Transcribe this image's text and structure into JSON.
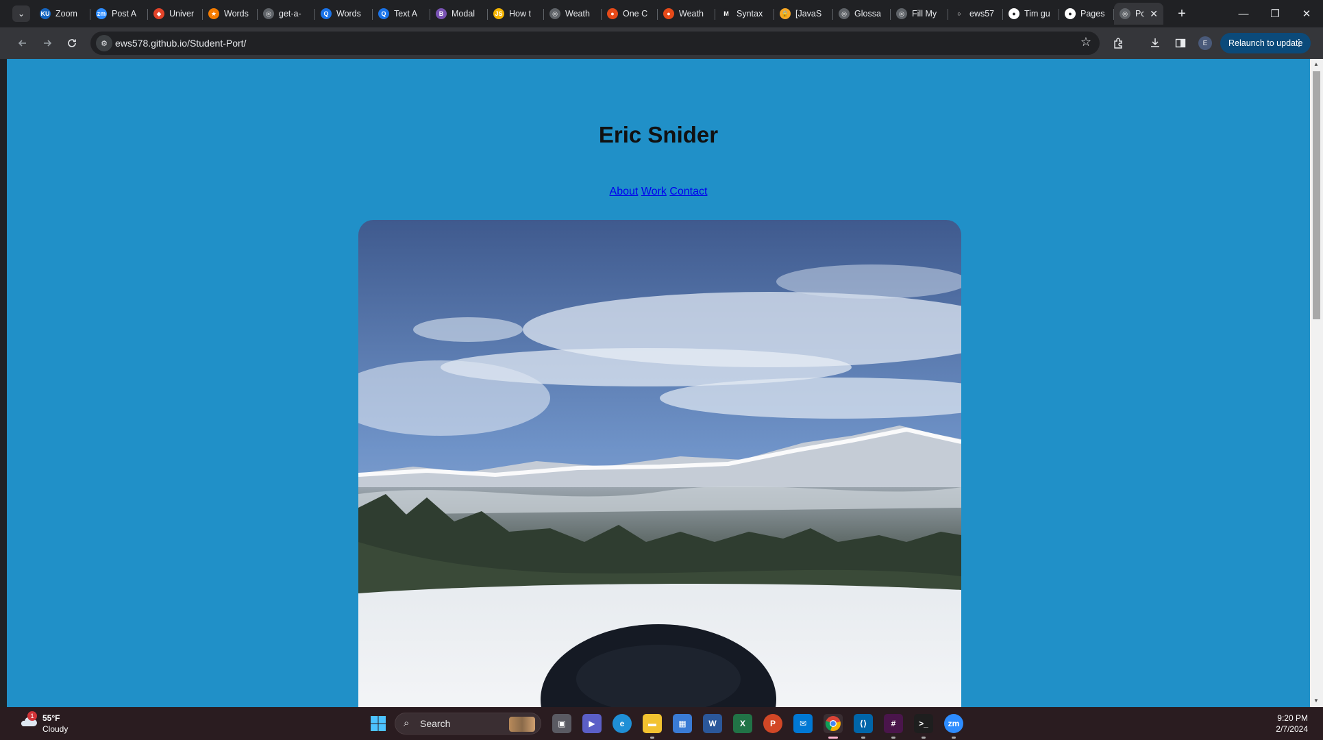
{
  "browser": {
    "tabs": [
      {
        "title": "Zoom",
        "favicon": "zoom-ku-icon",
        "color": "#1565c0",
        "glyph": "KU"
      },
      {
        "title": "Post A",
        "favicon": "zoom-icon",
        "color": "#2d8cff",
        "glyph": "zm"
      },
      {
        "title": "Univer",
        "favicon": "gitlab-icon",
        "color": "#e24329",
        "glyph": "◆"
      },
      {
        "title": "Words",
        "favicon": "star-icon",
        "color": "#f57c00",
        "glyph": "★"
      },
      {
        "title": "get-a-",
        "favicon": "globe-icon",
        "color": "#5f6368",
        "glyph": "◎"
      },
      {
        "title": "Words",
        "favicon": "q-icon",
        "color": "#1a73e8",
        "glyph": "Q"
      },
      {
        "title": "Text A",
        "favicon": "q-icon",
        "color": "#1a73e8",
        "glyph": "Q"
      },
      {
        "title": "Modal",
        "favicon": "bootstrap-icon",
        "color": "#7952b3",
        "glyph": "B"
      },
      {
        "title": "How t",
        "favicon": "w3schools-icon",
        "color": "#f4b400",
        "glyph": "JS"
      },
      {
        "title": "Weath",
        "favicon": "globe-icon",
        "color": "#5f6368",
        "glyph": "◎"
      },
      {
        "title": "One C",
        "favicon": "brain-icon",
        "color": "#e64a19",
        "glyph": "●"
      },
      {
        "title": "Weath",
        "favicon": "brain-icon",
        "color": "#e64a19",
        "glyph": "●"
      },
      {
        "title": "Syntax",
        "favicon": "mdn-icon",
        "color": "#202124",
        "glyph": "M"
      },
      {
        "title": "[JavaS",
        "favicon": "lock-icon",
        "color": "#f9a825",
        "glyph": "🔒"
      },
      {
        "title": "Glossa",
        "favicon": "globe-icon",
        "color": "#5f6368",
        "glyph": "◎"
      },
      {
        "title": "Fill My",
        "favicon": "globe-icon",
        "color": "#5f6368",
        "glyph": "◎"
      },
      {
        "title": "ews57",
        "favicon": "github-icon",
        "color": "#202124",
        "glyph": "○"
      },
      {
        "title": "Tim gu",
        "favicon": "github-icon",
        "color": "#ffffff",
        "glyph": "●"
      },
      {
        "title": "Pages",
        "favicon": "github-icon",
        "color": "#ffffff",
        "glyph": "●"
      },
      {
        "title": "Po",
        "favicon": "globe-icon",
        "color": "#5f6368",
        "glyph": "◎",
        "active": true
      }
    ],
    "url": "ews578.github.io/Student-Port/",
    "profile_initial": "E",
    "relaunch_label": "Relaunch to update"
  },
  "page": {
    "title": "Eric Snider",
    "nav_links": [
      "About",
      "Work",
      "Contact"
    ],
    "background_color": "#2090c8",
    "link_color": "#0000ee"
  },
  "taskbar": {
    "weather": {
      "temp": "55°F",
      "condition": "Cloudy",
      "badge": "1"
    },
    "search_placeholder": "Search",
    "time": "9:20 PM",
    "date": "2/7/2024"
  }
}
